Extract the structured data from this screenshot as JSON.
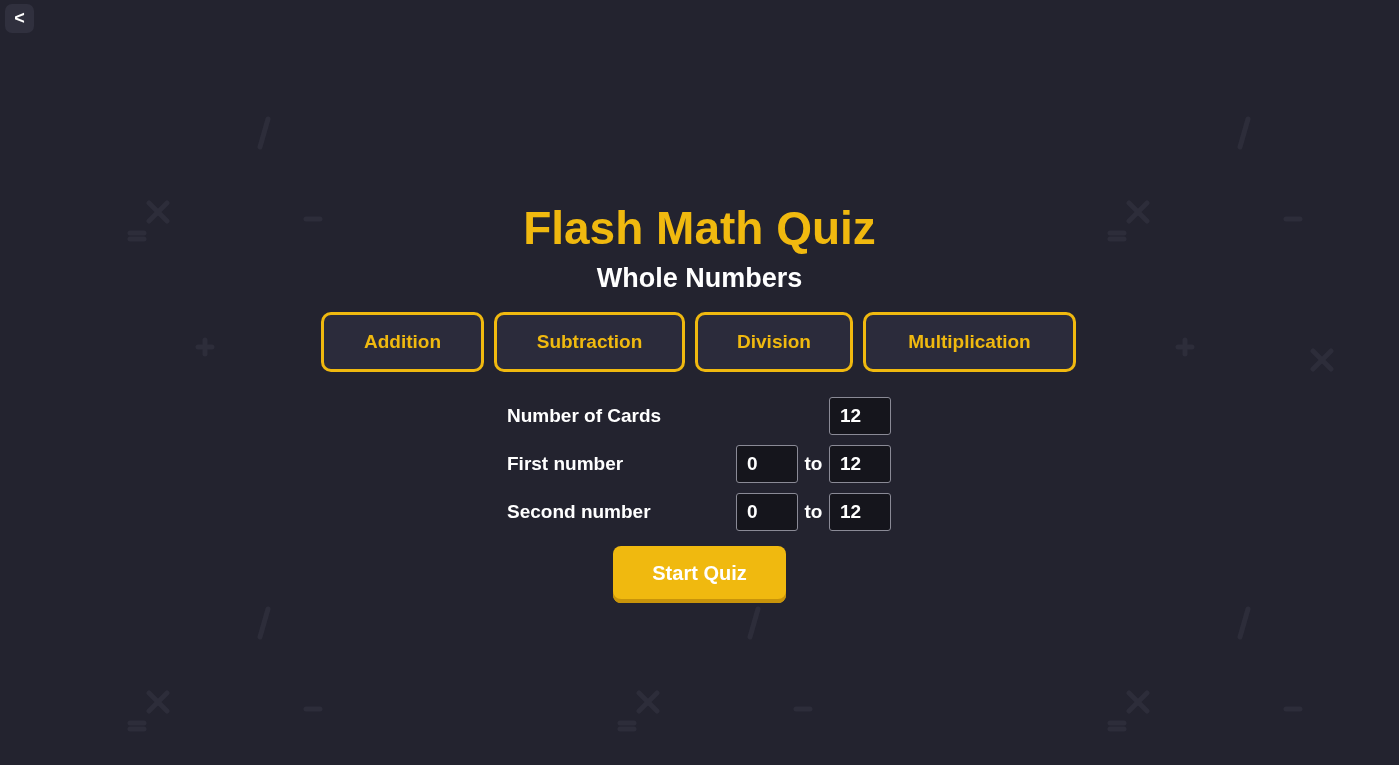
{
  "back_button": {
    "label": "<"
  },
  "title": "Flash Math Quiz",
  "subtitle": "Whole Numbers",
  "operations": [
    "Addition",
    "Subtraction",
    "Division",
    "Multiplication"
  ],
  "settings": [
    {
      "label": "Number of Cards",
      "value": "12"
    },
    {
      "label": "First number",
      "from": "0",
      "separator": "to",
      "to": "12"
    },
    {
      "label": "Second number",
      "from": "0",
      "separator": "to",
      "to": "12"
    }
  ],
  "start_button": "Start Quiz"
}
